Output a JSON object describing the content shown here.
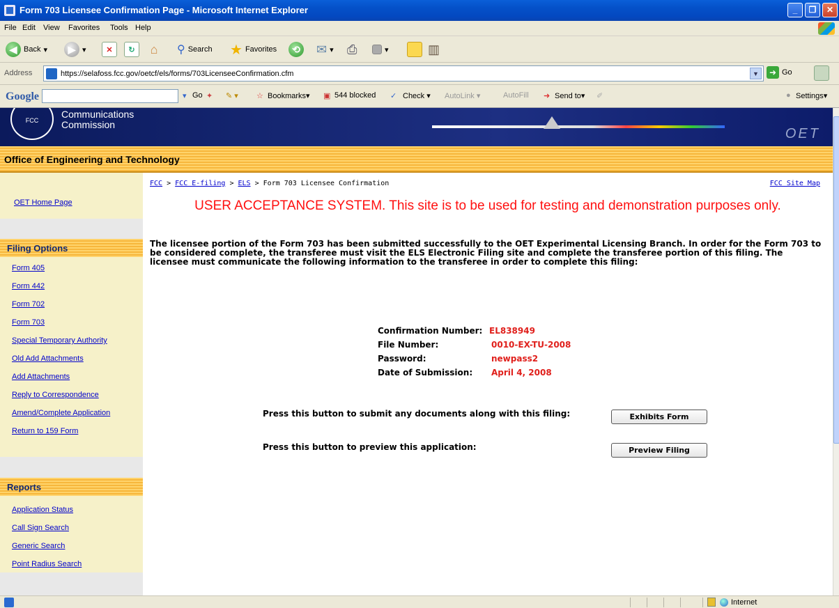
{
  "window": {
    "title": "Form 703 Licensee Confirmation Page - Microsoft Internet Explorer"
  },
  "menu": [
    "File",
    "Edit",
    "View",
    "Favorites",
    "Tools",
    "Help"
  ],
  "toolbar": {
    "back": "Back",
    "search": "Search",
    "favorites": "Favorites"
  },
  "address": {
    "label": "Address",
    "url": "https://selafoss.fcc.gov/oetcf/els/forms/703LicenseeConfirmation.cfm",
    "go": "Go"
  },
  "googlebar": {
    "logo": "Google",
    "go": "Go",
    "bookmarks": "Bookmarks▾",
    "blocked": "544 blocked",
    "check": "Check ▾",
    "autolink": "AutoLink ▾",
    "autofill": "AutoFill",
    "sendto": "Send to▾",
    "settings": "Settings▾"
  },
  "banner": {
    "org_line1": "Communications",
    "org_line2": "Commission",
    "seal_text": "FCC",
    "oet": "OET"
  },
  "office": "Office of Engineering and Technology",
  "sidebar": {
    "home": "OET Home Page",
    "filing_title": "Filing Options",
    "filing": [
      "Form 405",
      "Form 442",
      "Form 702",
      "Form 703",
      "Special Temporary Authority",
      "Old Add Attachments",
      "Add Attachments",
      "Reply to Correspondence",
      "Amend/Complete Application",
      "Return to 159 Form"
    ],
    "reports_title": "Reports",
    "reports": [
      "Application Status",
      "Call Sign Search",
      "Generic Search",
      "Point Radius Search"
    ]
  },
  "breadcrumb": {
    "fcc": "FCC",
    "sep": ">",
    "efiling": "FCC E-filing",
    "els": "ELS",
    "current": "Form 703 Licensee Confirmation",
    "sitemap": "FCC Site Map"
  },
  "uas_notice": "USER ACCEPTANCE SYSTEM. This site is to be used for testing and demonstration purposes only.",
  "message": "The licensee portion of the Form 703 has been submitted successfully to the OET Experimental Licensing Branch. In order for the Form 703 to be considered complete, the transferee must visit the ELS Electronic Filing site and complete the transferee portion of this filing. The licensee must communicate the following information to the transferee in order to complete this filing:",
  "confirmation": [
    {
      "label": "Confirmation Number:",
      "value": "EL838949"
    },
    {
      "label": "File Number:",
      "value": "0010-EX-TU-2008"
    },
    {
      "label": "Password:",
      "value": "newpass2"
    },
    {
      "label": "Date of Submission:",
      "value": "April 4, 2008"
    }
  ],
  "actions": {
    "exhibits_prompt": "Press this button to submit any documents along with this filing:",
    "exhibits_button": "Exhibits Form",
    "preview_prompt": "Press this button to preview this application:",
    "preview_button": "Preview Filing"
  },
  "status": {
    "zone": "Internet"
  }
}
